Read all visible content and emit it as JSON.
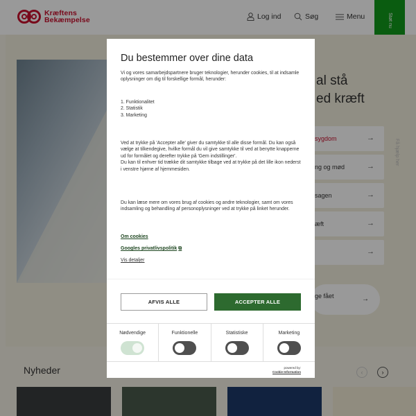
{
  "header": {
    "logo_line1": "Kræftens",
    "logo_line2": "Bekæmpelse",
    "login": "Log ind",
    "search": "Søg",
    "menu": "Menu",
    "stot": "Støt nu"
  },
  "background": {
    "hero_title_line1": "al stå",
    "hero_title_line2": "ed kræft",
    "rows": [
      "sygdom",
      "ng og mød",
      "sagen",
      "æft",
      ""
    ],
    "side_text": "Få hjælp her",
    "pill_text": "ge fået",
    "news_title": "Nyheder"
  },
  "modal": {
    "title": "Du bestemmer over dine data",
    "intro": "Vi og vores samarbejdspartnere bruger teknologier, herunder cookies, til at indsamle oplysninger om dig til forskellige formål, herunder:",
    "list": [
      "1. Funktionalitet",
      "2. Statistik",
      "3. Marketing"
    ],
    "consent_p1": "Ved at trykke på 'Accepter alle' giver du samtykke til alle disse formål. Du kan også vælge at tilkendegive, hvilke formål du vil give samtykke til ved at benytte knapperne ud for formålet og derefter trykke på 'Gem indstillinger'.",
    "consent_p2": "Du kan til enhver tid trække dit samtykke tilbage ved at trykke på det lille ikon nederst i venstre hjørne af hjemmesiden.",
    "more_info": "Du kan læse mere om vores brug af cookies og andre teknologier, samt om vores indsamling og behandling af personoplysninger ved at trykke på linket herunder.",
    "link_cookies": "Om cookies",
    "link_google": "Googles privatlivspolitik",
    "link_details": "Vis detaljer",
    "reject": "AFVIS ALLE",
    "accept": "ACCEPTER ALLE",
    "toggles": [
      {
        "label": "Nødvendige",
        "on": true
      },
      {
        "label": "Funktionelle",
        "on": false
      },
      {
        "label": "Statistiske",
        "on": false
      },
      {
        "label": "Marketing",
        "on": false
      }
    ],
    "powered_by": "powered by:",
    "powered_name": "Cookie Information"
  },
  "colors": {
    "brand_red": "#c8102e",
    "accept_green": "#2d6a2f",
    "stot_green": "#12991c"
  }
}
